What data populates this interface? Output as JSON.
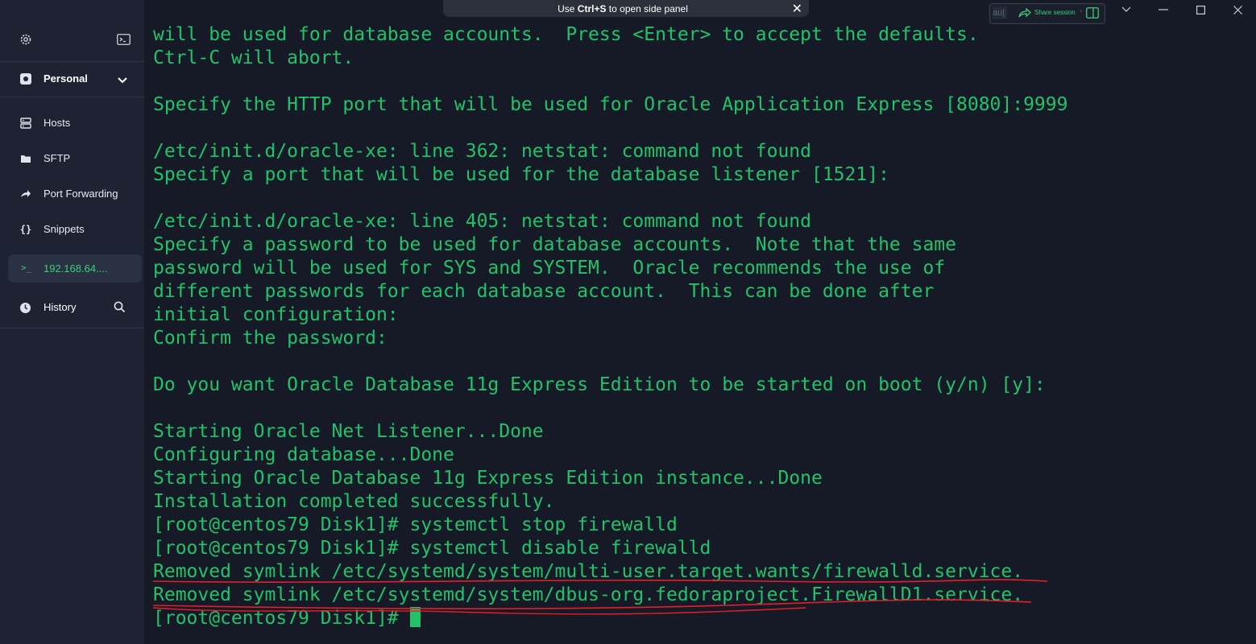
{
  "sidebar": {
    "vault": {
      "label": "Personal"
    },
    "nav": [
      {
        "label": "Hosts",
        "icon": "hosts-icon"
      },
      {
        "label": "SFTP",
        "icon": "folder-icon"
      },
      {
        "label": "Port Forwarding",
        "icon": "port-forwarding-icon"
      },
      {
        "label": "Snippets",
        "icon": "snippets-icon"
      }
    ],
    "session": {
      "label": "192.168.64....",
      "icon": ">_"
    },
    "history": {
      "label": "History"
    }
  },
  "hint_bar": {
    "prefix": "Use ",
    "shortcut": "Ctrl+S",
    "suffix": " to open side panel",
    "close": "✕"
  },
  "share": {
    "label": "Share session",
    "field_value": "au|"
  },
  "terminal": {
    "lines": [
      "will be used for database accounts.  Press <Enter> to accept the defaults.",
      "Ctrl-C will abort.",
      "",
      "Specify the HTTP port that will be used for Oracle Application Express [8080]:9999",
      "",
      "/etc/init.d/oracle-xe: line 362: netstat: command not found",
      "Specify a port that will be used for the database listener [1521]:",
      "",
      "/etc/init.d/oracle-xe: line 405: netstat: command not found",
      "Specify a password to be used for database accounts.  Note that the same",
      "password will be used for SYS and SYSTEM.  Oracle recommends the use of",
      "different passwords for each database account.  This can be done after",
      "initial configuration:",
      "Confirm the password:",
      "",
      "Do you want Oracle Database 11g Express Edition to be started on boot (y/n) [y]:",
      "",
      "Starting Oracle Net Listener...Done",
      "Configuring database...Done",
      "Starting Oracle Database 11g Express Edition instance...Done",
      "Installation completed successfully.",
      "[root@centos79 Disk1]# systemctl stop firewalld",
      "[root@centos79 Disk1]# systemctl disable firewalld",
      "Removed symlink /etc/systemd/system/multi-user.target.wants/firewalld.service.",
      "Removed symlink /etc/systemd/system/dbus-org.fedoraproject.FirewallD1.service.",
      "[root@centos79 Disk1]# "
    ],
    "text_color": "#21c36a",
    "background": "#151a26",
    "annotation_color": "#e0202a"
  }
}
